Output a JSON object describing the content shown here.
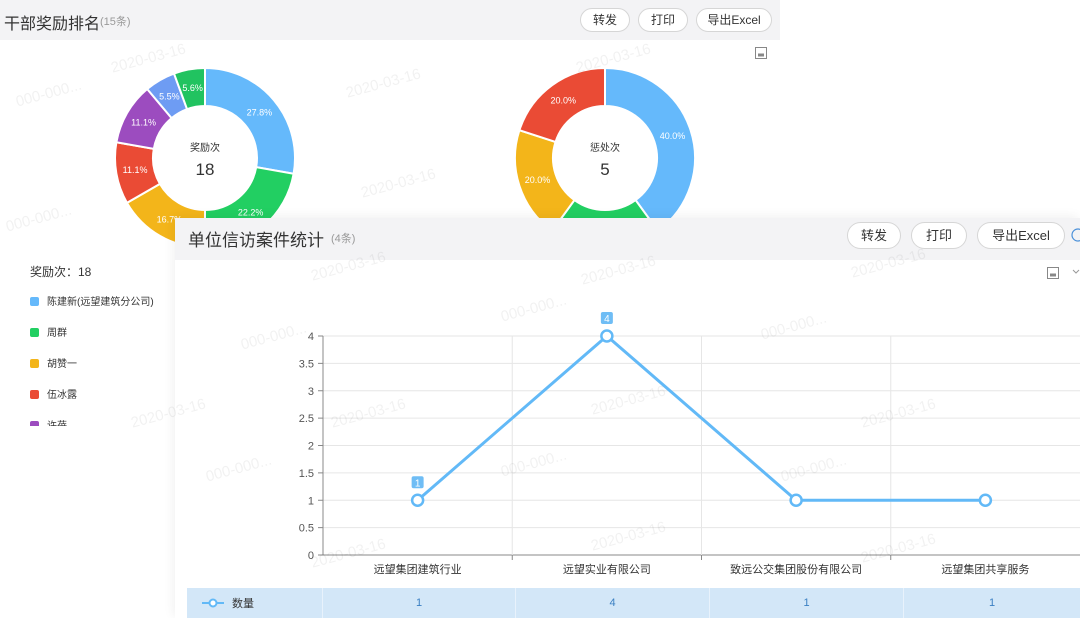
{
  "award_panel": {
    "title": "干部奖励排名",
    "count": "(15条)",
    "buttons": {
      "forward": "转发",
      "print": "打印",
      "export": "导出Excel"
    },
    "donut_left": {
      "center_label": "奖励次",
      "center_value": "18",
      "slices": [
        {
          "label": "27.8%",
          "percent": 27.8,
          "color": "#65b9fb"
        },
        {
          "label": "22.2%",
          "percent": 22.2,
          "color": "#22cf62"
        },
        {
          "label": "16.7%",
          "percent": 16.7,
          "color": "#f3b51a"
        },
        {
          "label": "11.1%",
          "percent": 11.1,
          "color": "#ea4b35"
        },
        {
          "label": "11.1%",
          "percent": 11.1,
          "color": "#9c4cbf"
        },
        {
          "label": "5.5%",
          "percent": 5.5,
          "color": "#6e9cf3"
        },
        {
          "label": "5.6%",
          "percent": 5.6,
          "color": "#21c360"
        }
      ]
    },
    "donut_right": {
      "center_label": "惩处次",
      "center_value": "5",
      "slices": [
        {
          "label": "40.0%",
          "percent": 40.0,
          "color": "#65b9fb"
        },
        {
          "label": "20.0%",
          "percent": 20.0,
          "color": "#22cf62"
        },
        {
          "label": "20.0%",
          "percent": 20.0,
          "color": "#f3b51a"
        },
        {
          "label": "20.0%",
          "percent": 20.0,
          "color": "#ea4b35"
        }
      ]
    },
    "legend": {
      "title": "奖励次：18",
      "items": [
        {
          "name": "陈建新(远望建筑分公司)",
          "color": "#65b9fb"
        },
        {
          "name": "周群",
          "color": "#22cf62"
        },
        {
          "name": "胡赞一",
          "color": "#f3b51a"
        },
        {
          "name": "伍冰露",
          "color": "#ea4b35"
        },
        {
          "name": "许蓓",
          "color": "#9c4cbf"
        }
      ]
    }
  },
  "petition_panel": {
    "title": "单位信访案件统计",
    "count": "(4条)",
    "buttons": {
      "forward": "转发",
      "print": "打印",
      "export": "导出Excel"
    },
    "series_label": "数量",
    "row_values": [
      "1",
      "4",
      "1",
      "1"
    ]
  },
  "chart_data": {
    "type": "line",
    "categories": [
      "远望集团建筑行业",
      "远望实业有限公司",
      "致远公交集团股份有限公司",
      "远望集团共享服务"
    ],
    "series": [
      {
        "name": "数量",
        "values": [
          1,
          4,
          1,
          1
        ],
        "color": "#62b9f7"
      }
    ],
    "point_labels": [
      "1",
      "4",
      "",
      ""
    ],
    "y_ticks": [
      "0",
      "0.5",
      "1",
      "1.5",
      "2",
      "2.5",
      "3",
      "3.5",
      "4"
    ],
    "ylim": [
      0,
      4
    ],
    "grid": true
  },
  "watermark": {
    "date": "2020-03-16",
    "user": "000-000..."
  }
}
